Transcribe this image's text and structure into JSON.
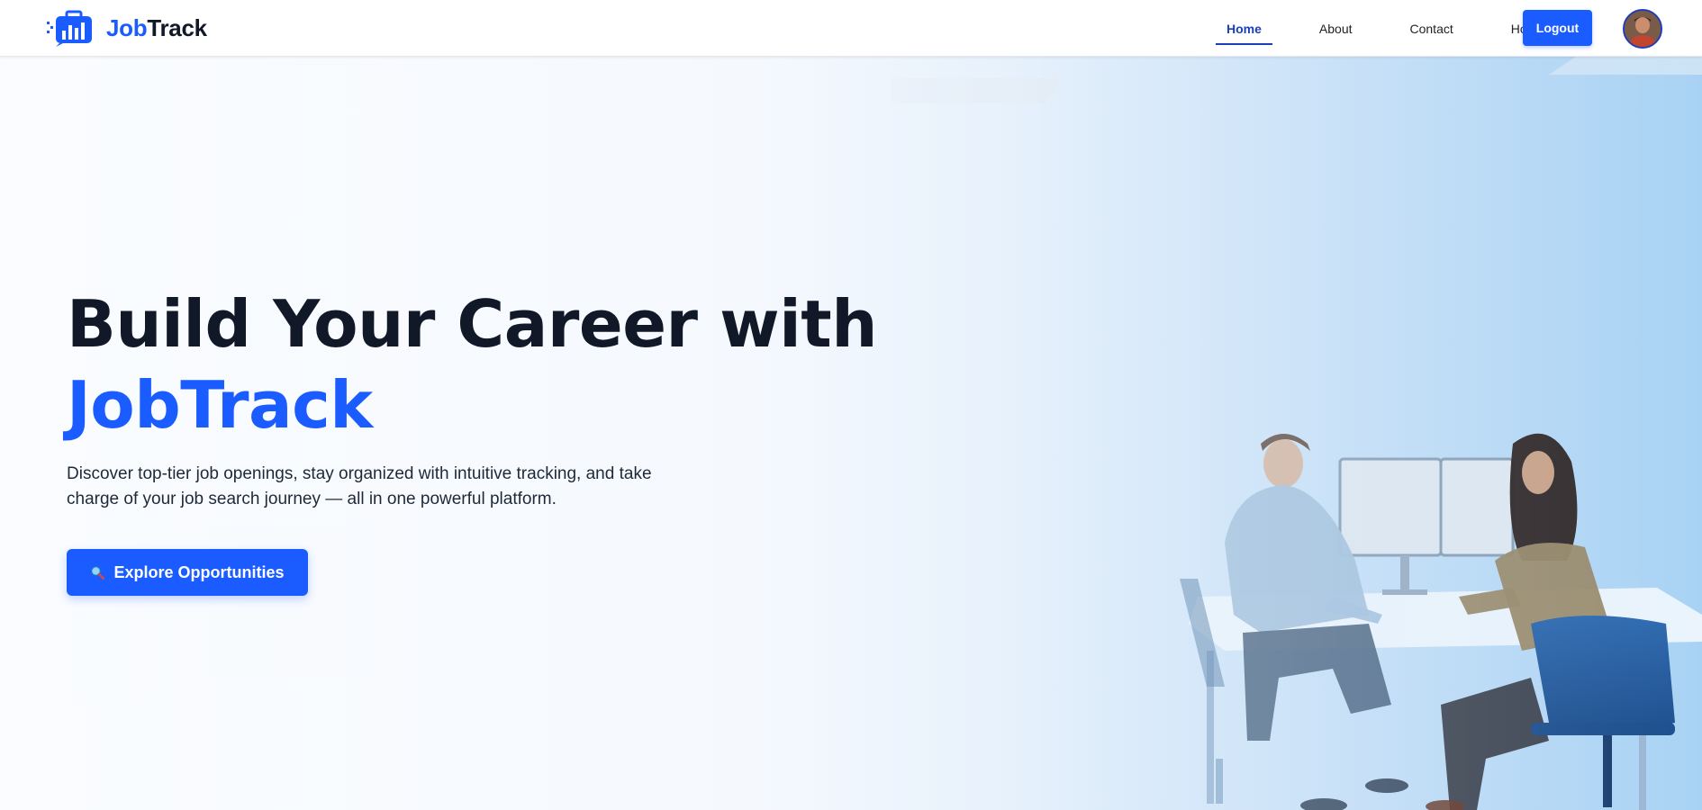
{
  "brand": {
    "name_part1": "Job",
    "name_part2": "Track",
    "logo_icon": "briefcase-chart-icon",
    "accent_color": "#1a5cff"
  },
  "nav": {
    "links": [
      {
        "label": "Home",
        "active": true
      },
      {
        "label": "About",
        "active": false
      },
      {
        "label": "Contact",
        "active": false
      },
      {
        "label": "Hot Jobs",
        "active": false
      }
    ],
    "logout_label": "Logout",
    "avatar_icon": "user-avatar"
  },
  "hero": {
    "title_line1": "Build Your Career with",
    "title_line2": "JobTrack",
    "subtitle": "Discover top-tier job openings, stay organized with intuitive tracking, and take charge of your job search journey — all in one powerful platform.",
    "cta_label": "Explore Opportunities",
    "cta_icon": "magnifier-icon",
    "background_image": "office-workers-at-computers-photo"
  },
  "colors": {
    "primary": "#1a5cff",
    "nav_active": "#1a3fb8",
    "heading": "#111827"
  }
}
